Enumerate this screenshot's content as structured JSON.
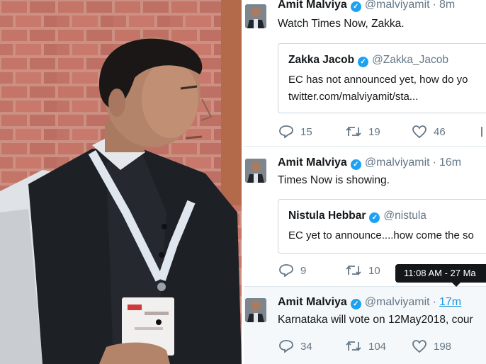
{
  "tweets": [
    {
      "name": "Amit Malviya",
      "handle": "@malviyamit",
      "time": "8m",
      "text": "Watch Times Now, Zakka.",
      "quote": {
        "name": "Zakka Jacob",
        "handle": "@Zakka_Jacob",
        "line1": "EC has not announced yet, how do yo",
        "line2": "twitter.com/malviyamit/sta..."
      },
      "replies": "15",
      "retweets": "19",
      "likes": "46"
    },
    {
      "name": "Amit Malviya",
      "handle": "@malviyamit",
      "time": "16m",
      "text": "Times Now is showing.",
      "quote": {
        "name": "Nistula Hebbar",
        "handle": "@nistula",
        "line1": "EC yet to announce....how come the so"
      },
      "replies": "9",
      "retweets": "10",
      "likes": ""
    },
    {
      "name": "Amit Malviya",
      "handle": "@malviyamit",
      "time": "17m",
      "text": "Karnataka will vote on 12May2018, cour",
      "replies": "34",
      "retweets": "104",
      "likes": "198"
    }
  ],
  "tooltip": "11:08 AM - 27 Ma",
  "colors": {
    "verified": "#1da1f2",
    "link": "#1b95e0",
    "muted": "#657786",
    "text": "#14171a",
    "tooltip_bg": "#14171a"
  },
  "icons": [
    "reply-icon",
    "retweet-icon",
    "like-icon",
    "verified-icon"
  ]
}
